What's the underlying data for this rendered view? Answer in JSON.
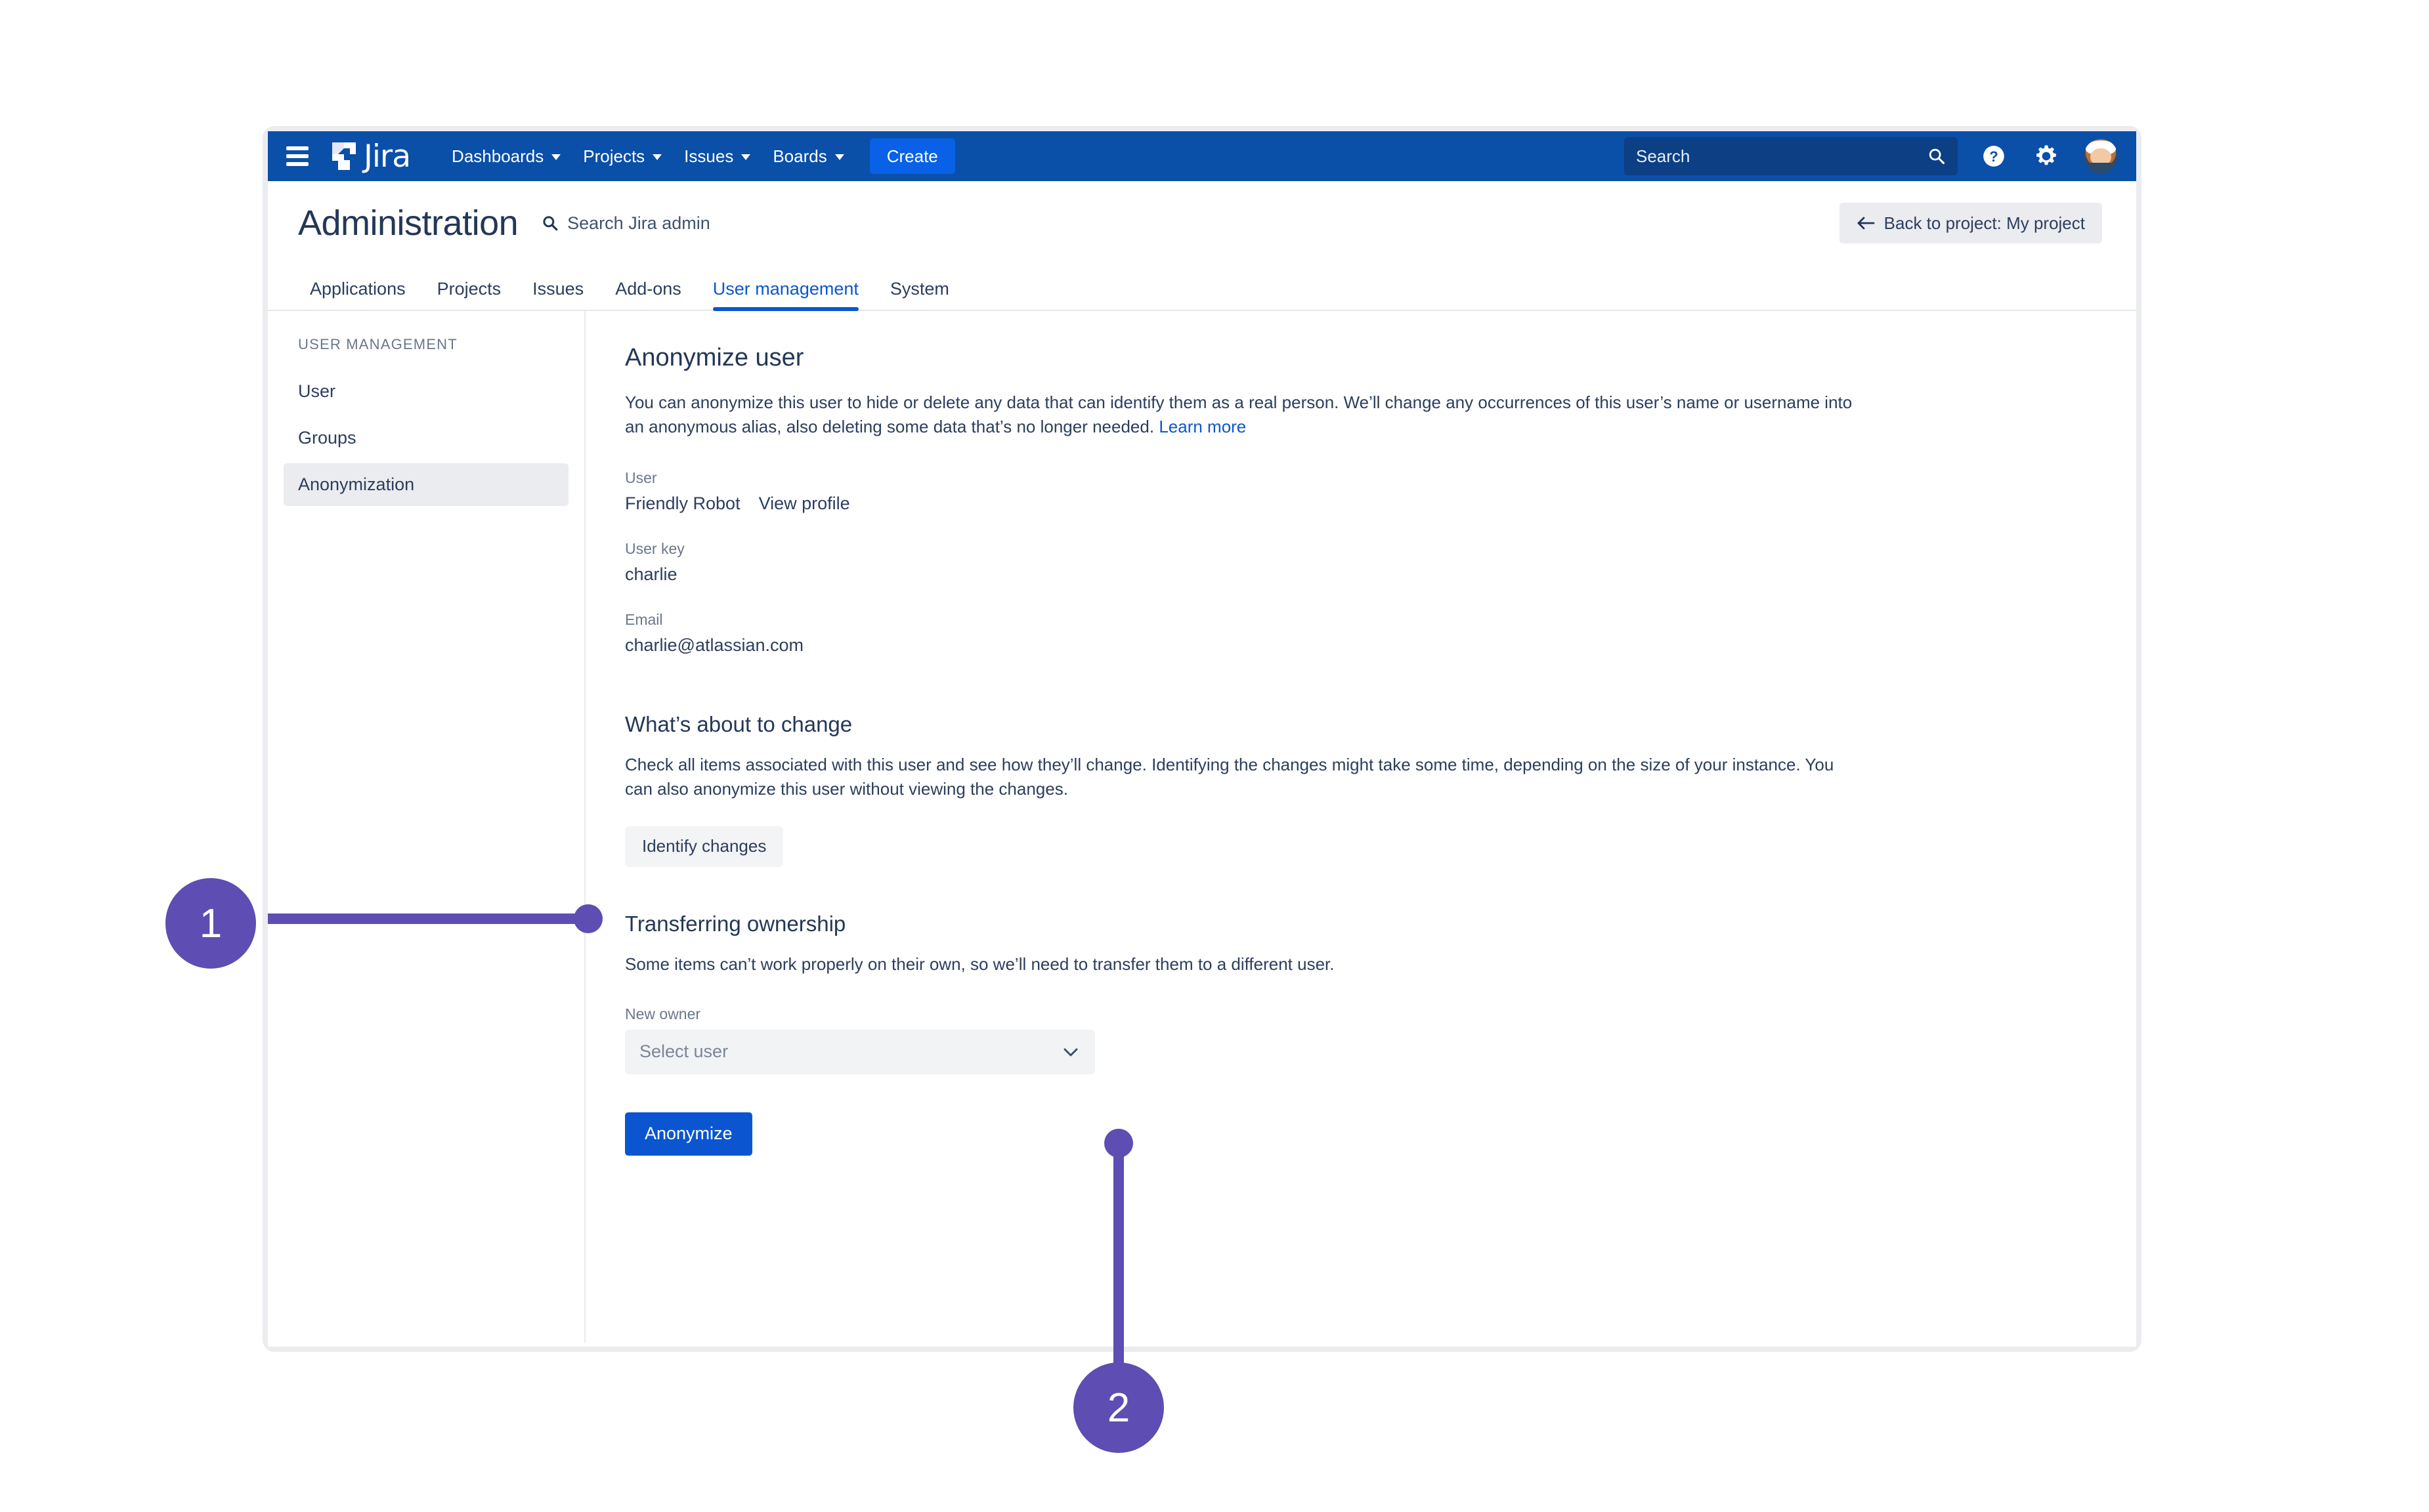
{
  "topnav": {
    "brand": "Jira",
    "menu_hamburger_icon": "hamburger-menu-icon",
    "items": [
      {
        "label": "Dashboards",
        "has_caret": true
      },
      {
        "label": "Projects",
        "has_caret": true
      },
      {
        "label": "Issues",
        "has_caret": true
      },
      {
        "label": "Boards",
        "has_caret": true
      }
    ],
    "create_label": "Create",
    "search_placeholder": "Search",
    "search_value": "",
    "search_icon": "search-icon",
    "help_icon": "help-circle-icon",
    "settings_icon": "gear-icon",
    "avatar_icon": "user-avatar",
    "brand_color": "#0a4fa8",
    "create_color": "#0861e6"
  },
  "admin_header": {
    "title": "Administration",
    "search_label": "Search Jira admin",
    "search_icon": "search-icon",
    "back_button_label": "Back to project: My project",
    "back_arrow_icon": "arrow-left-icon"
  },
  "tabs": [
    {
      "label": "Applications",
      "active": false
    },
    {
      "label": "Projects",
      "active": false
    },
    {
      "label": "Issues",
      "active": false
    },
    {
      "label": "Add-ons",
      "active": false
    },
    {
      "label": "User management",
      "active": true
    },
    {
      "label": "System",
      "active": false
    }
  ],
  "sidebar": {
    "heading": "USER MANAGEMENT",
    "items": [
      {
        "label": "User",
        "active": false
      },
      {
        "label": "Groups",
        "active": false
      },
      {
        "label": "Anonymization",
        "active": true
      }
    ]
  },
  "main": {
    "page_title": "Anonymize user",
    "intro_text": "You can anonymize this user to hide or delete any data that can identify them as a real person. We’ll change any occurrences of this user’s name or username into an anonymous alias, also deleting some data that’s no longer needed. ",
    "intro_link": "Learn more",
    "user_label": "User",
    "user_name": "Friendly Robot",
    "view_profile_link": "View profile",
    "user_key_label": "User key",
    "user_key_value": "charlie",
    "email_label": "Email",
    "email_value": "charlie@atlassian.com",
    "changes_title": "What’s about to change",
    "changes_text": "Check all items associated with this user and see how they’ll change. Identifying the changes might take some time, depending on the size of your instance. You can also anonymize this user without viewing the changes.",
    "identify_changes_label": "Identify changes",
    "transfer_title": "Transferring ownership",
    "transfer_text": "Some items can’t work properly on their own, so we’ll need to transfer them to a different user.",
    "new_owner_label": "New owner",
    "new_owner_placeholder": "Select user",
    "new_owner_value": "",
    "new_owner_caret_icon": "chevron-down-icon",
    "anonymize_label": "Anonymize"
  },
  "annotations": {
    "accent_color": "#5e4db2",
    "markers": [
      {
        "number": "1",
        "target": "identify-changes-button"
      },
      {
        "number": "2",
        "target": "new-owner-select"
      }
    ]
  }
}
